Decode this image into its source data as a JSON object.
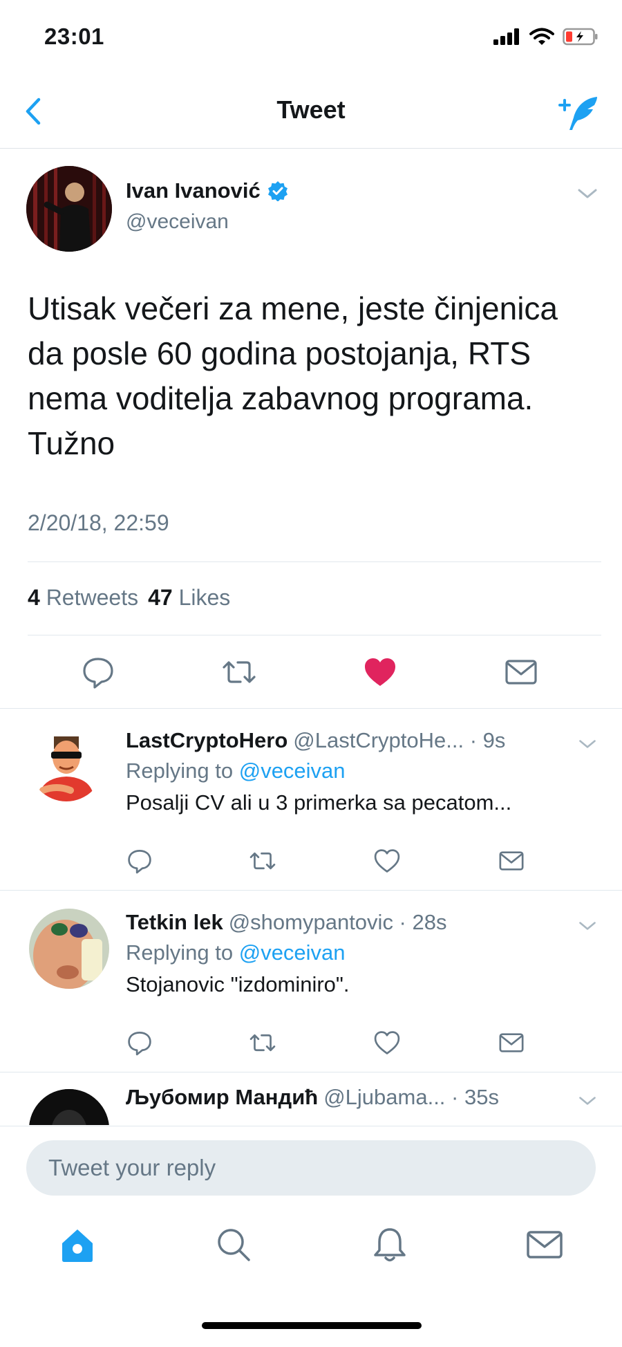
{
  "status_bar": {
    "time": "23:01"
  },
  "nav": {
    "title": "Tweet"
  },
  "tweet": {
    "author_name": "Ivan Ivanović",
    "author_handle": "@veceivan",
    "text_lines": [
      "Utisak večeri za mene, jeste činjenica",
      "da posle 60 godina postojanja, RTS",
      "nema voditelja zabavnog programa.",
      "Tužno"
    ],
    "timestamp": "2/20/18, 22:59",
    "retweets_count": "4",
    "retweets_label": "Retweets",
    "likes_count": "47",
    "likes_label": "Likes",
    "liked": true
  },
  "replies": [
    {
      "name": "LastCryptoHero",
      "handle": "@LastCryptoHe... · 9s",
      "replying_prefix": "Replying to",
      "replying_to": "@veceivan",
      "text": "Posalji CV ali u 3 primerka sa pecatom..."
    },
    {
      "name": "Tetkin lek",
      "handle": "@shomypantovic · 28s",
      "replying_prefix": "Replying to",
      "replying_to": "@veceivan",
      "text": "Stojanovic \"izdominiro\"."
    },
    {
      "name": "Љубомир Мандић",
      "handle": "@Ljubama...  · 35s"
    }
  ],
  "composer": {
    "placeholder": "Tweet your reply"
  },
  "tab_bar": {
    "items": [
      "home-icon",
      "search-icon",
      "notifications-icon",
      "messages-icon"
    ],
    "active": "home-icon"
  },
  "colors": {
    "accent": "#1da1f2",
    "like": "#e0245e",
    "secondary_text": "#657786"
  }
}
